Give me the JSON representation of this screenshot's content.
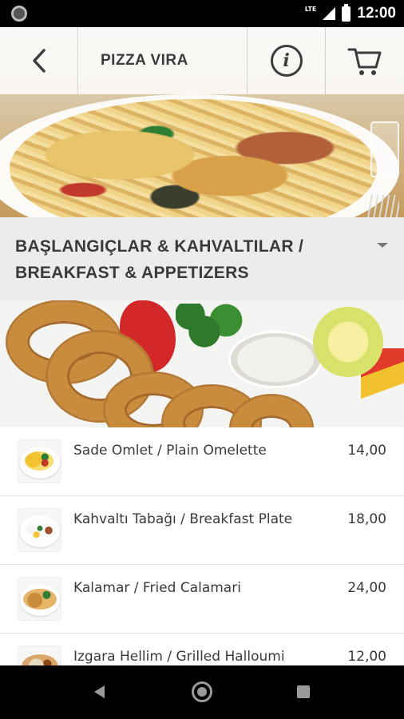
{
  "status_bar": {
    "time": "12:00",
    "network": "LTE"
  },
  "toolbar": {
    "title": "PIZZA VIRA",
    "back_icon": "chevron-left-icon",
    "info_icon": "info-icon",
    "cart_icon": "cart-icon"
  },
  "category": {
    "label_line1": "BAŞLANGIÇLAR & KAHVALTILAR /",
    "label_line2": "BREAKFAST & APPETIZERS",
    "dropdown_icon": "caret-down-icon"
  },
  "items": [
    {
      "name": "Sade Omlet / Plain Omelette",
      "price": "14,00"
    },
    {
      "name": "Kahvaltı Tabağı / Breakfast Plate",
      "price": "18,00"
    },
    {
      "name": "Kalamar / Fried Calamari",
      "price": "24,00"
    },
    {
      "name": "Izgara Hellim / Grilled Halloumi",
      "price": "12,00"
    }
  ],
  "nav_bar": {
    "back_icon": "nav-back-icon",
    "home_icon": "nav-home-icon",
    "recents_icon": "nav-recents-icon"
  },
  "colors": {
    "text_dark": "#3a3a3a",
    "category_bg": "#ececec",
    "divider": "#e0e0e0"
  }
}
